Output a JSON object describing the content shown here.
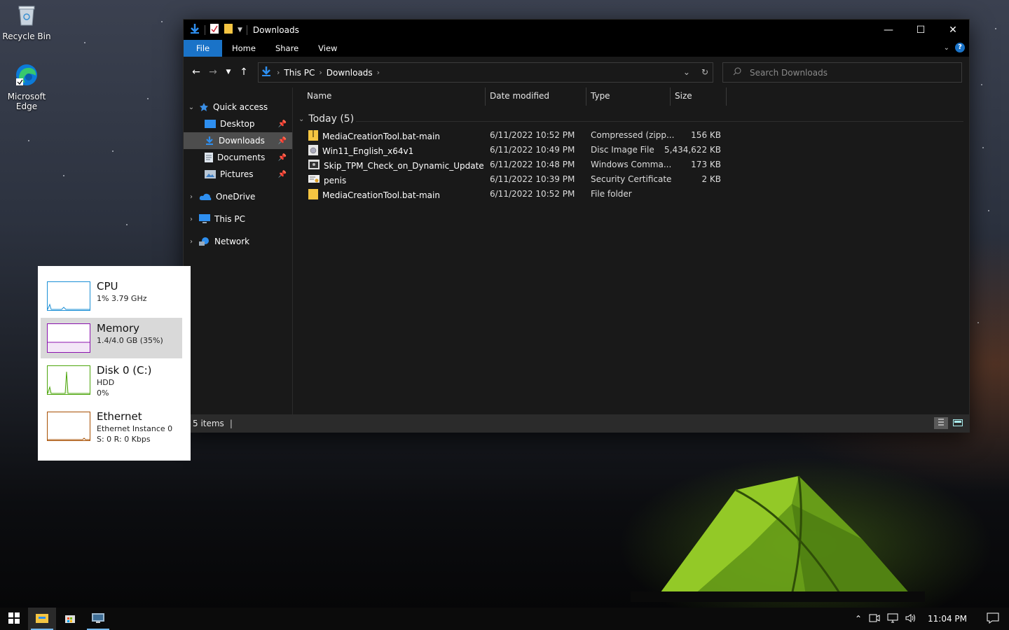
{
  "desktop": {
    "icons": [
      {
        "label": "Recycle Bin"
      },
      {
        "label": "Microsoft Edge"
      }
    ]
  },
  "explorer": {
    "title": "Downloads",
    "ribbon_tabs": [
      "File",
      "Home",
      "Share",
      "View"
    ],
    "address": {
      "crumbs": [
        "This PC",
        "Downloads"
      ]
    },
    "search_placeholder": "Search Downloads",
    "nav": {
      "quick_access": "Quick access",
      "pinned": [
        "Desktop",
        "Downloads",
        "Documents",
        "Pictures"
      ],
      "selected": "Downloads",
      "onedrive": "OneDrive",
      "this_pc": "This PC",
      "network": "Network"
    },
    "columns": {
      "name": "Name",
      "date": "Date modified",
      "type": "Type",
      "size": "Size"
    },
    "group_label": "Today (5)",
    "files": [
      {
        "name": "MediaCreationTool.bat-main",
        "date": "6/11/2022 10:52 PM",
        "type": "Compressed (zipp...",
        "size": "156 KB",
        "icon": "zip-icon"
      },
      {
        "name": "Win11_English_x64v1",
        "date": "6/11/2022 10:49 PM",
        "type": "Disc Image File",
        "size": "5,434,622 KB",
        "icon": "disc-image-icon"
      },
      {
        "name": "Skip_TPM_Check_on_Dynamic_Update",
        "date": "6/11/2022 10:48 PM",
        "type": "Windows Comma...",
        "size": "173 KB",
        "icon": "script-icon"
      },
      {
        "name": "penis",
        "date": "6/11/2022 10:39 PM",
        "type": "Security Certificate",
        "size": "2 KB",
        "icon": "certificate-icon"
      },
      {
        "name": "MediaCreationTool.bat-main",
        "date": "6/11/2022 10:52 PM",
        "type": "File folder",
        "size": "",
        "icon": "folder-icon"
      }
    ],
    "status": "5 items"
  },
  "performance": {
    "items": [
      {
        "title": "CPU",
        "line1": "1% 3.79 GHz",
        "line2": "",
        "color": "#1b8fd6"
      },
      {
        "title": "Memory",
        "line1": "1.4/4.0 GB (35%)",
        "line2": "",
        "color": "#8b12ae"
      },
      {
        "title": "Disk 0 (C:)",
        "line1": "HDD",
        "line2": "0%",
        "color": "#4da60c"
      },
      {
        "title": "Ethernet",
        "line1": "Ethernet Instance 0",
        "line2": "S: 0 R: 0 Kbps",
        "color": "#a74f01"
      }
    ]
  },
  "taskbar": {
    "clock": "11:04 PM"
  },
  "colors": {
    "accent": "#1a73c8",
    "window_bg": "#191919",
    "selection": "#4d4d4d"
  }
}
